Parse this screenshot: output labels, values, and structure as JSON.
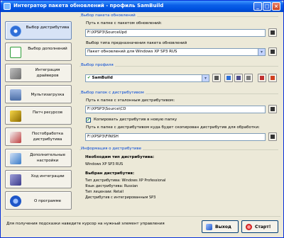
{
  "window": {
    "title": "Интегратор пакета обновлений - профиль SamBuild"
  },
  "sidebar": {
    "items": [
      {
        "label": "Выбор дистрибутива",
        "icon": "disc-icon",
        "color": "#2E6FD8"
      },
      {
        "label": "Выбор дополнений",
        "icon": "checklist-icon",
        "color": "#2E9E3A"
      },
      {
        "label": "Интеграция драйверов",
        "icon": "driver-icon",
        "color": "#7A7A7A"
      },
      {
        "label": "Мультизагрузка",
        "icon": "multiboot-icon",
        "color": "#4D6FA8"
      },
      {
        "label": "Патч ресурсов",
        "icon": "patch-icon",
        "color": "#D4A017"
      },
      {
        "label": "Постобработка дистрибутива",
        "icon": "postprocess-icon",
        "color": "#C04040"
      },
      {
        "label": "Дополнительные настройки",
        "icon": "settings-icon",
        "color": "#3A7BC8"
      },
      {
        "label": "Ход интеграции",
        "icon": "progress-icon",
        "color": "#3A3A8C"
      },
      {
        "label": "О программе",
        "icon": "info-icon",
        "color": "#1E56C8"
      }
    ]
  },
  "service_pack": {
    "group_title": "Выбор пакета обновлений",
    "path_label": "Путь к папке с пакетом обновлений:",
    "path_value": "F:\\XPSP3\\SourceUpd",
    "type_label": "Выбор типа предназначения пакета обновлений",
    "type_value": "Пакет обновлений для Windows XP SP3 RUS"
  },
  "profile": {
    "group_title": "Выбор профиля",
    "value": "SamBuild"
  },
  "distrib_folder": {
    "group_title": "Выбор папок с дистрибутивом",
    "source_label": "Путь к папке с эталонным дистрибутивом:",
    "source_value": "F:\\XPSP3\\Source\\CD",
    "copy_label": "Копировать дистрибутив в новую папку",
    "copy_checked": true,
    "dest_label": "Путь к папке с дистрибутивом куда будет скопирован дистрибутив для обработки:",
    "dest_value": "F:\\XPSP3\\FINISH"
  },
  "distrib_info": {
    "group_title": "Информация о дистрибутиве",
    "needed_head": "Необходим тип дистрибутива:",
    "needed_value": "Windows XP SP3 RUS",
    "chosen_head": "Выбран дистрибутив:",
    "lines": [
      "Тип дистрибутива: Windows XP Professional",
      "Язык дистрибутива: Russian",
      "Тип лицензии: Retail",
      "Дистрибутив с интегрированным SP3"
    ]
  },
  "bottom": {
    "hint": "Для получения подсказки наведите курсор на нужный элемент управления",
    "exit_label": "Выход",
    "start_label": "Старт!"
  }
}
